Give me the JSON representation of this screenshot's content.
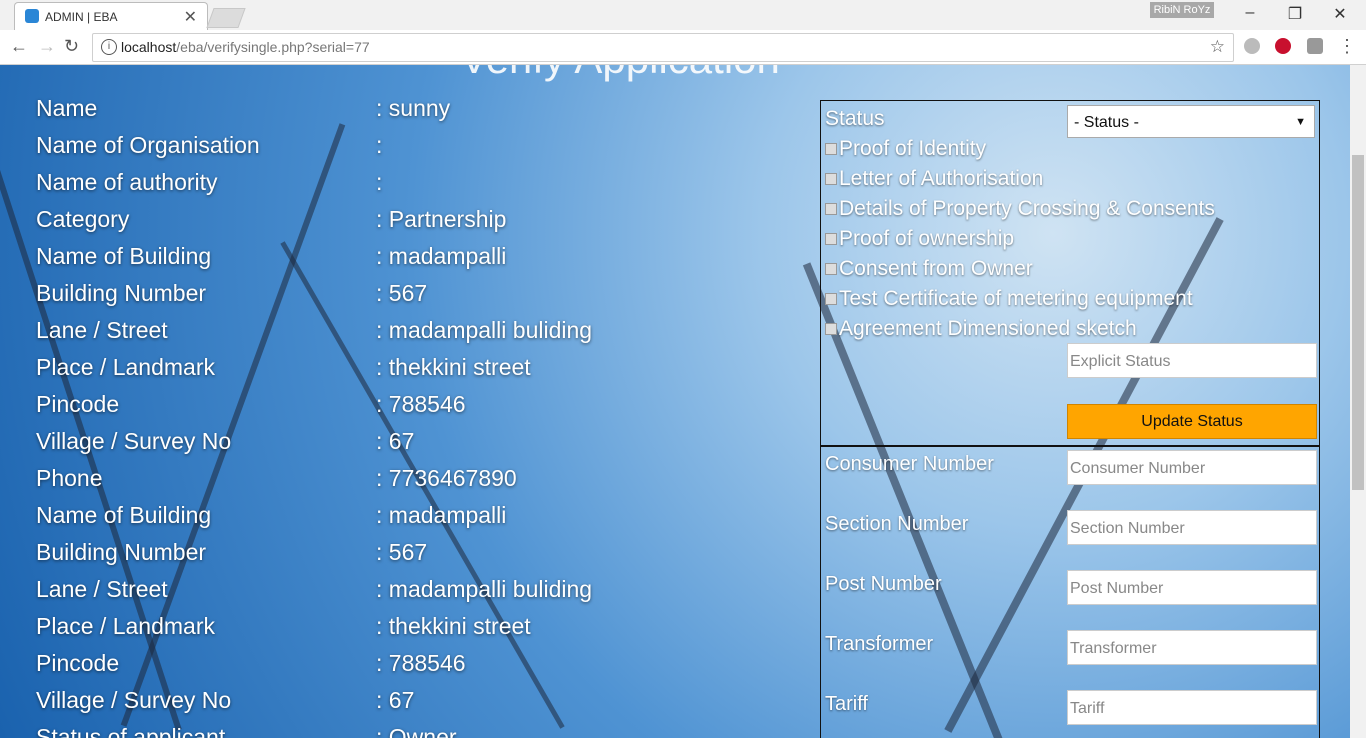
{
  "browser": {
    "tab_title": "ADMIN | EBA",
    "tab_close": "✕",
    "profile": "RibiN RoYz",
    "url_host": "localhost",
    "url_path": "/eba/verifysingle.php?serial=77"
  },
  "page": {
    "heading": "Verify Application",
    "fields": [
      {
        "label": "Name",
        "value": ": sunny"
      },
      {
        "label": "Name of Organisation",
        "value": ":"
      },
      {
        "label": "Name of authority",
        "value": ":"
      },
      {
        "label": "Category",
        "value": ": Partnership"
      },
      {
        "label": "Name of Building",
        "value": ": madampalli"
      },
      {
        "label": "Building Number",
        "value": ": 567"
      },
      {
        "label": "Lane / Street",
        "value": ": madampalli buliding"
      },
      {
        "label": "Place / Landmark",
        "value": ": thekkini street"
      },
      {
        "label": "Pincode",
        "value": ": 788546"
      },
      {
        "label": "Village / Survey No",
        "value": ": 67"
      },
      {
        "label": "Phone",
        "value": ": 7736467890"
      },
      {
        "label": "Name of Building",
        "value": ": madampalli"
      },
      {
        "label": "Building Number",
        "value": ": 567"
      },
      {
        "label": "Lane / Street",
        "value": ": madampalli buliding"
      },
      {
        "label": "Place / Landmark",
        "value": ": thekkini street"
      },
      {
        "label": "Pincode",
        "value": ": 788546"
      },
      {
        "label": "Village / Survey No",
        "value": ": 67"
      },
      {
        "label": "Status of applicant",
        "value": ": Owner"
      }
    ],
    "status_panel": {
      "status_label": "Status",
      "status_select": "- Status -",
      "checks": [
        "Proof of Identity",
        "Letter of Authorisation",
        "Details of Property Crossing & Consents",
        "Proof of ownership",
        "Consent from Owner",
        "Test Certificate of metering equipment",
        "Agreement Dimensioned sketch"
      ],
      "explicit_placeholder": "Explicit Status",
      "update_button": "Update Status"
    },
    "consumer_panel": {
      "items": [
        {
          "label": "Consumer Number",
          "placeholder": "Consumer Number"
        },
        {
          "label": "Section Number",
          "placeholder": "Section Number"
        },
        {
          "label": "Post Number",
          "placeholder": "Post Number"
        },
        {
          "label": "Transformer",
          "placeholder": "Transformer"
        },
        {
          "label": "Tariff",
          "placeholder": "Tariff"
        }
      ]
    }
  },
  "colors": {
    "accent_button": "#ffa500"
  }
}
